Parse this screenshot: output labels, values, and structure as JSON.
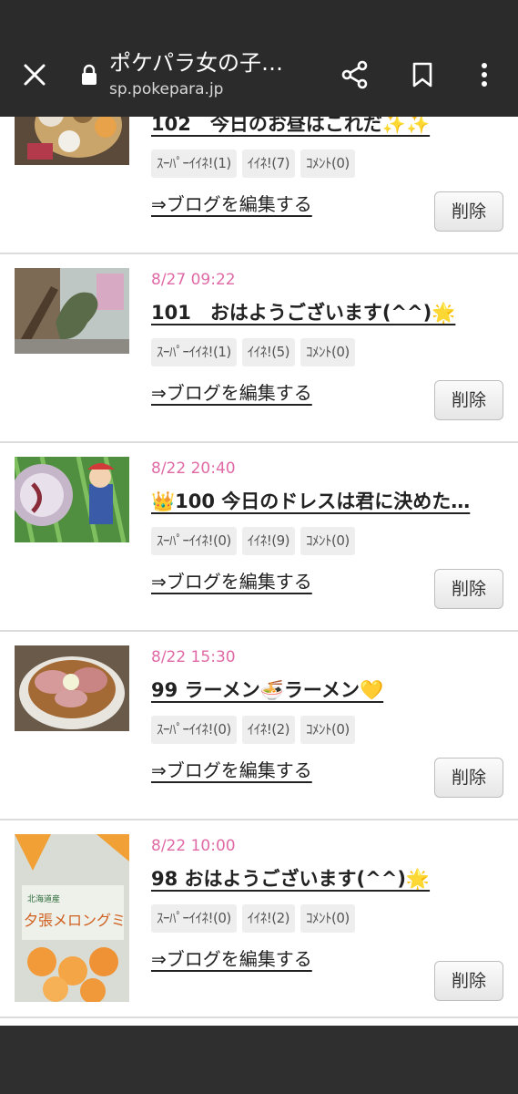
{
  "browser": {
    "title": "ポケパラ女の子…",
    "url": "sp.pokepara.jp",
    "bg_color": "#2b2b2b"
  },
  "posts": [
    {
      "date": "",
      "title": "102　今日のお昼はこれだ✨✨",
      "super_like": "ｽｰﾊﾟｰｲｲﾈ!(1)",
      "like": "ｲｲﾈ!(7)",
      "comment": "ｺﾒﾝﾄ(0)",
      "edit": "⇒ブログを編集する",
      "delete": "削除",
      "thumb": "food-tray"
    },
    {
      "date": "8/27 09:22",
      "title": "101　おはようございます(^^)🌟",
      "super_like": "ｽｰﾊﾟｰｲｲﾈ!(1)",
      "like": "ｲｲﾈ!(5)",
      "comment": "ｺﾒﾝﾄ(0)",
      "edit": "⇒ブログを編集する",
      "delete": "削除",
      "thumb": "dinosaur"
    },
    {
      "date": "8/22 20:40",
      "title": "👑100 今日のドレスは君に決めた…",
      "super_like": "ｽｰﾊﾟｰｲｲﾈ!(0)",
      "like": "ｲｲﾈ!(9)",
      "comment": "ｺﾒﾝﾄ(0)",
      "edit": "⇒ブログを編集する",
      "delete": "削除",
      "thumb": "anime"
    },
    {
      "date": "8/22 15:30",
      "title": "99 ラーメン🍜ラーメン💛",
      "super_like": "ｽｰﾊﾟｰｲｲﾈ!(0)",
      "like": "ｲｲﾈ!(2)",
      "comment": "ｺﾒﾝﾄ(0)",
      "edit": "⇒ブログを編集する",
      "delete": "削除",
      "thumb": "ramen"
    },
    {
      "date": "8/22 10:00",
      "title": "98 おはようございます(^^)🌟",
      "super_like": "ｽｰﾊﾟｰｲｲﾈ!(0)",
      "like": "ｲｲﾈ!(2)",
      "comment": "ｺﾒﾝﾄ(0)",
      "edit": "⇒ブログを編集する",
      "delete": "削除",
      "thumb": "melon-snack",
      "thumb_text": "北海道産 夕張メロングミ"
    }
  ],
  "colors": {
    "date": "#e06aa5",
    "divider": "#dcdcdc"
  }
}
